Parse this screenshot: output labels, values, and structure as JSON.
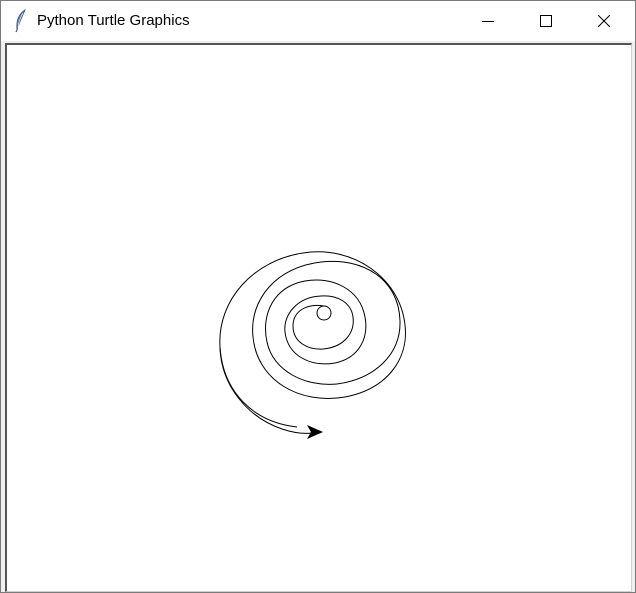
{
  "window": {
    "title": "Python Turtle Graphics",
    "icon": "feather-icon",
    "controls": {
      "minimize": "minimize-icon",
      "maximize": "maximize-icon",
      "close": "close-icon"
    }
  },
  "canvas": {
    "background": "#ffffff",
    "pen_color": "#000000",
    "drawing": "spiral",
    "turtle_shape": "arrow",
    "turtle_heading": "east"
  }
}
